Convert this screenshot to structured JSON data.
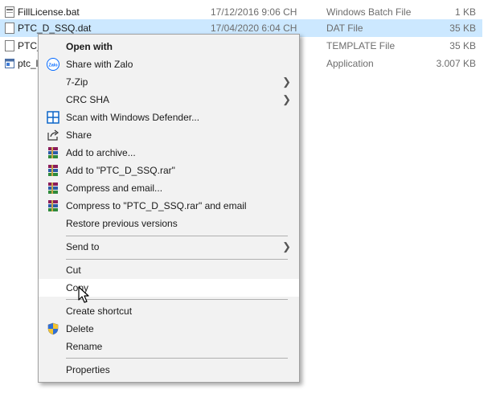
{
  "files": [
    {
      "name": "FillLicense.bat",
      "date": "17/12/2016 9:06 CH",
      "type": "Windows Batch File",
      "size": "1 KB"
    },
    {
      "name": "PTC_D_SSQ.dat",
      "date": "17/04/2020 6:04 CH",
      "type": "DAT File",
      "size": "35 KB"
    },
    {
      "name": "PTC_",
      "date": "",
      "type": "TEMPLATE File",
      "size": "35 KB"
    },
    {
      "name": "ptc_l",
      "date": "",
      "type": "Application",
      "size": "3.007 KB"
    }
  ],
  "menu": {
    "open_with": "Open with",
    "share_zalo": "Share with Zalo",
    "zalo_badge": "Zalo",
    "seven_zip": "7-Zip",
    "crc_sha": "CRC SHA",
    "scan_defender": "Scan with Windows Defender...",
    "share": "Share",
    "add_archive": "Add to archive...",
    "add_rar": "Add to \"PTC_D_SSQ.rar\"",
    "compress_email": "Compress and email...",
    "compress_rar_email": "Compress to \"PTC_D_SSQ.rar\" and email",
    "restore_versions": "Restore previous versions",
    "send_to": "Send to",
    "cut": "Cut",
    "copy": "Copy",
    "create_shortcut": "Create shortcut",
    "delete": "Delete",
    "rename": "Rename",
    "properties": "Properties"
  },
  "colors": {
    "selection": "#cce8ff",
    "menu_bg": "#f2f2f2",
    "menu_hover": "#ffffff",
    "zalo_blue": "#0068ff",
    "defender_blue": "#0a64c8"
  },
  "icons": {
    "arrow": "chevron-right-icon",
    "winrar": "winrar-books-icon"
  }
}
